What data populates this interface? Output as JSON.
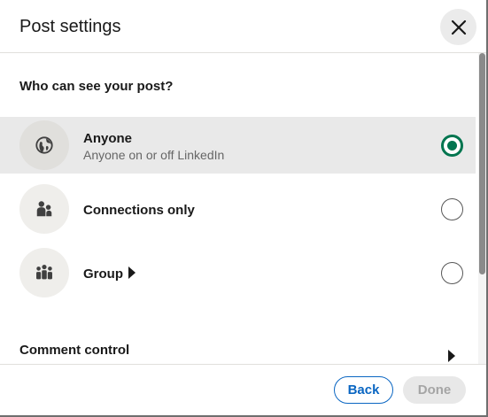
{
  "header": {
    "title": "Post settings"
  },
  "visibility": {
    "question": "Who can see your post?",
    "options": [
      {
        "title": "Anyone",
        "subtitle": "Anyone on or off LinkedIn",
        "selected": true,
        "icon": "globe-icon"
      },
      {
        "title": "Connections only",
        "selected": false,
        "icon": "people-icon"
      },
      {
        "title": "Group",
        "selected": false,
        "icon": "group-icon"
      }
    ]
  },
  "comment_control": {
    "title": "Comment control"
  },
  "footer": {
    "back_label": "Back",
    "done_label": "Done"
  },
  "colors": {
    "accent": "#0a66c2",
    "selected_radio": "#01754f",
    "selected_row": "#e9e9e9"
  }
}
